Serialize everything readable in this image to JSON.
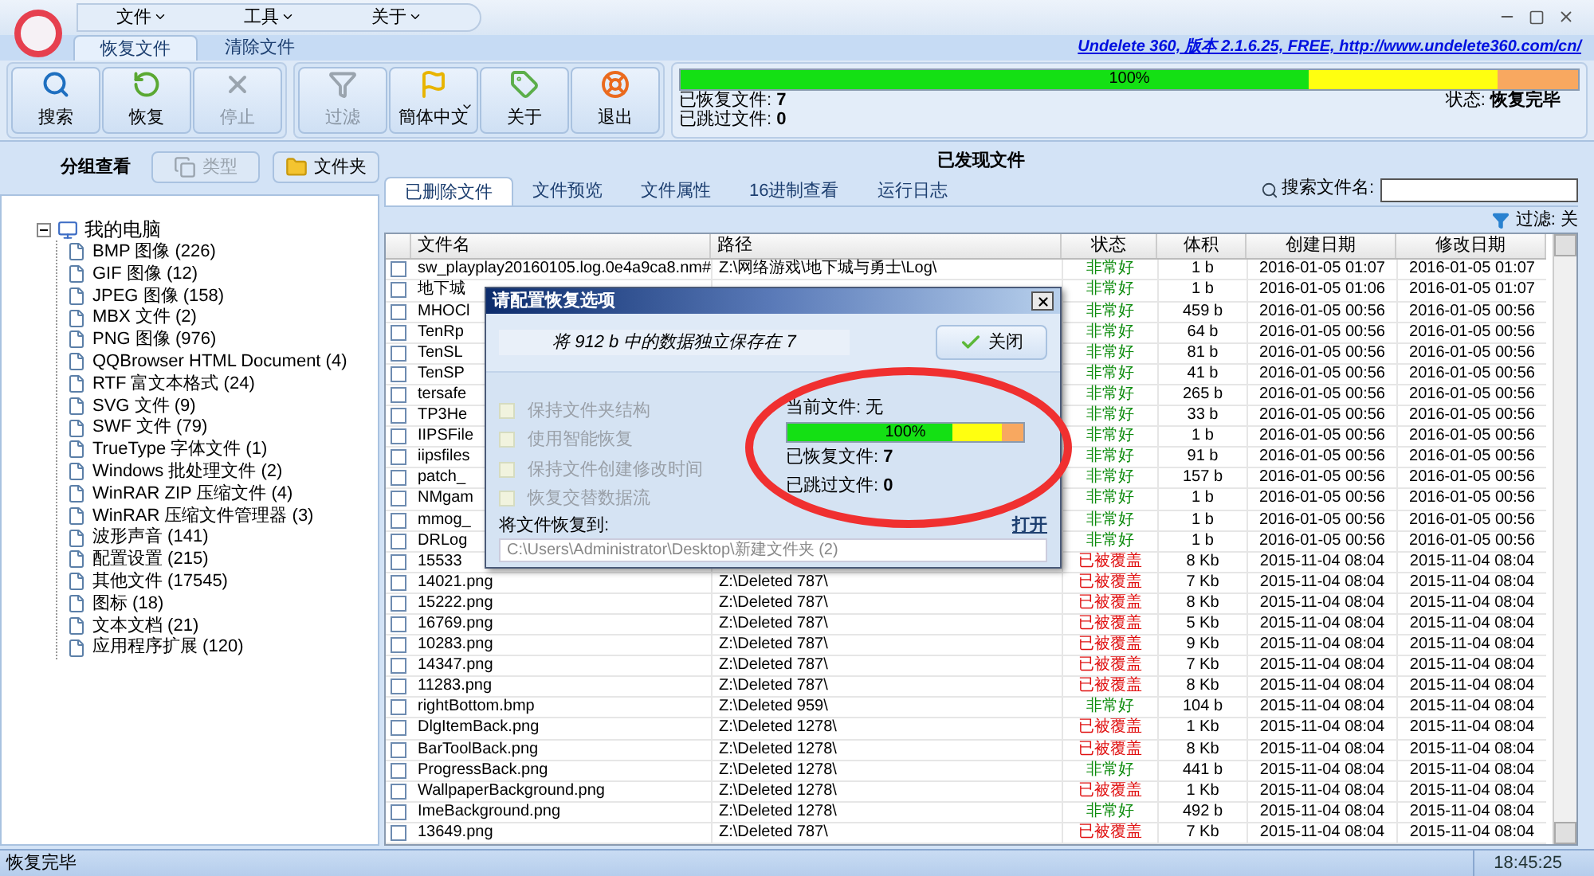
{
  "menu": [
    {
      "label": "文件"
    },
    {
      "label": "工具"
    },
    {
      "label": "关于"
    }
  ],
  "ribbon": {
    "tabs": [
      {
        "label": "恢复文件",
        "selected": true
      },
      {
        "label": "清除文件",
        "selected": false
      }
    ],
    "link": "Undelete 360, 版本 2.1.6.25, FREE, http://www.undelete360.com/cn/",
    "groups": [
      [
        {
          "label": "搜索",
          "kind": "search",
          "disabled": false
        },
        {
          "label": "恢复",
          "kind": "restore",
          "disabled": false
        },
        {
          "label": "停止",
          "kind": "stop",
          "disabled": true
        }
      ],
      [
        {
          "label": "过滤",
          "kind": "filter",
          "disabled": true
        },
        {
          "label": "簡体中文",
          "kind": "language",
          "disabled": false,
          "dropdown": true
        },
        {
          "label": "关于",
          "kind": "about",
          "disabled": false
        },
        {
          "label": "退出",
          "kind": "exit",
          "disabled": false
        }
      ]
    ],
    "progress": {
      "level": 1,
      "label": "100%",
      "recovered": "已恢复文件: **7**",
      "skipped": "已跳过文件: **0**",
      "status": "状态: **恢复完毕**"
    }
  },
  "group_view": {
    "label": "分组查看",
    "buttons": [
      {
        "label": "类型",
        "kind": "type",
        "disabled": true
      },
      {
        "label": "文件夹",
        "kind": "folder",
        "disabled": false
      }
    ]
  },
  "tree": {
    "label": "我的电脑",
    "expanded": true,
    "children": [
      {
        "label": "BMP 图像 (226)"
      },
      {
        "label": "GIF 图像 (12)"
      },
      {
        "label": "JPEG 图像 (158)"
      },
      {
        "label": "MBX 文件 (2)"
      },
      {
        "label": "PNG 图像 (976)"
      },
      {
        "label": "QQBrowser HTML Document (4)"
      },
      {
        "label": "RTF 富文本格式 (24)"
      },
      {
        "label": "SVG 文件 (9)"
      },
      {
        "label": "SWF 文件 (79)"
      },
      {
        "label": "TrueType 字体文件 (1)"
      },
      {
        "label": "Windows 批处理文件 (2)"
      },
      {
        "label": "WinRAR ZIP 压缩文件 (4)"
      },
      {
        "label": "WinRAR 压缩文件管理器 (3)"
      },
      {
        "label": "波形声音 (141)"
      },
      {
        "label": "配置设置 (215)"
      },
      {
        "label": "其他文件 (17545)"
      },
      {
        "label": "图标 (18)"
      },
      {
        "label": "文本文档 (21)"
      },
      {
        "label": "应用程序扩展 (120)"
      }
    ]
  },
  "found": {
    "title": "已发现文件",
    "tabs": [
      {
        "label": "已删除文件",
        "selected": true
      },
      {
        "label": "文件预览",
        "selected": false
      },
      {
        "label": "文件属性",
        "selected": false
      },
      {
        "label": "16进制查看",
        "selected": false
      },
      {
        "label": "运行日志",
        "selected": false
      }
    ],
    "search_label": "搜索文件名:",
    "filter": "过滤: 关",
    "columns": [
      "文件名",
      "路径",
      "状态",
      "体积",
      "创建日期",
      "修改日期"
    ],
    "rows": [
      {
        "checked": false,
        "name": "sw_playplay20160105.log.0e4a9ca8.nm#",
        "path": "Z:\\网络游戏\\地下城与勇士\\Log\\",
        "color": "#0a8a0a",
        "status": "非常好",
        "size": "1 b",
        "created": "2016-01-05 01:07",
        "modified": "2016-01-05 01:07"
      },
      {
        "checked": false,
        "name": "地下城",
        "color": "#0a8a0a",
        "status": "非常好",
        "size": "1 b",
        "created": "2016-01-05 01:06",
        "modified": "2016-01-05 01:07"
      },
      {
        "checked": false,
        "name": "MHOCl",
        "color": "#0a8a0a",
        "status": "非常好",
        "size": "459 b",
        "created": "2016-01-05 00:56",
        "modified": "2016-01-05 00:56"
      },
      {
        "checked": false,
        "name": "TenRp",
        "color": "#0a8a0a",
        "status": "非常好",
        "size": "64 b",
        "created": "2016-01-05 00:56",
        "modified": "2016-01-05 00:56"
      },
      {
        "checked": false,
        "name": "TenSL",
        "color": "#0a8a0a",
        "status": "非常好",
        "size": "81 b",
        "created": "2016-01-05 00:56",
        "modified": "2016-01-05 00:56"
      },
      {
        "checked": false,
        "name": "TenSP",
        "color": "#0a8a0a",
        "status": "非常好",
        "size": "41 b",
        "created": "2016-01-05 00:56",
        "modified": "2016-01-05 00:56"
      },
      {
        "checked": false,
        "name": "tersafe",
        "color": "#0a8a0a",
        "status": "非常好",
        "size": "265 b",
        "created": "2016-01-05 00:56",
        "modified": "2016-01-05 00:56"
      },
      {
        "checked": false,
        "name": "TP3He",
        "color": "#0a8a0a",
        "status": "非常好",
        "size": "33 b",
        "created": "2016-01-05 00:56",
        "modified": "2016-01-05 00:56"
      },
      {
        "checked": false,
        "name": "IIPSFile",
        "color": "#0a8a0a",
        "status": "非常好",
        "size": "1 b",
        "created": "2016-01-05 00:56",
        "modified": "2016-01-05 00:56"
      },
      {
        "checked": false,
        "name": "iipsfiles",
        "color": "#0a8a0a",
        "status": "非常好",
        "size": "91 b",
        "created": "2016-01-05 00:56",
        "modified": "2016-01-05 00:56"
      },
      {
        "checked": false,
        "name": "patch_",
        "color": "#0a8a0a",
        "status": "非常好",
        "size": "157 b",
        "created": "2016-01-05 00:56",
        "modified": "2016-01-05 00:56"
      },
      {
        "checked": false,
        "name": "NMgam",
        "color": "#0a8a0a",
        "status": "非常好",
        "size": "1 b",
        "created": "2016-01-05 00:56",
        "modified": "2016-01-05 00:56"
      },
      {
        "checked": false,
        "name": "mmog_",
        "color": "#0a8a0a",
        "status": "非常好",
        "size": "1 b",
        "created": "2016-01-05 00:56",
        "modified": "2016-01-05 00:56"
      },
      {
        "checked": false,
        "name": "DRLog",
        "color": "#0a8a0a",
        "status": "非常好",
        "size": "1 b",
        "created": "2016-01-05 00:56",
        "modified": "2016-01-05 00:56"
      },
      {
        "checked": false,
        "name": "15533",
        "color": "#e01010",
        "status": "已被覆盖",
        "size": "8 Kb",
        "created": "2015-11-04 08:04",
        "modified": "2015-11-04 08:04"
      },
      {
        "checked": false,
        "name": "14021.png",
        "path": "Z:\\Deleted 787\\",
        "color": "#e01010",
        "status": "已被覆盖",
        "size": "7 Kb",
        "created": "2015-11-04 08:04",
        "modified": "2015-11-04 08:04"
      },
      {
        "checked": false,
        "name": "15222.png",
        "path": "Z:\\Deleted 787\\",
        "color": "#e01010",
        "status": "已被覆盖",
        "size": "8 Kb",
        "created": "2015-11-04 08:04",
        "modified": "2015-11-04 08:04"
      },
      {
        "checked": false,
        "name": "16769.png",
        "path": "Z:\\Deleted 787\\",
        "color": "#e01010",
        "status": "已被覆盖",
        "size": "5 Kb",
        "created": "2015-11-04 08:04",
        "modified": "2015-11-04 08:04"
      },
      {
        "checked": false,
        "name": "10283.png",
        "path": "Z:\\Deleted 787\\",
        "color": "#e01010",
        "status": "已被覆盖",
        "size": "9 Kb",
        "created": "2015-11-04 08:04",
        "modified": "2015-11-04 08:04"
      },
      {
        "checked": false,
        "name": "14347.png",
        "path": "Z:\\Deleted 787\\",
        "color": "#e01010",
        "status": "已被覆盖",
        "size": "7 Kb",
        "created": "2015-11-04 08:04",
        "modified": "2015-11-04 08:04"
      },
      {
        "checked": false,
        "name": "11283.png",
        "path": "Z:\\Deleted 787\\",
        "color": "#e01010",
        "status": "已被覆盖",
        "size": "8 Kb",
        "created": "2015-11-04 08:04",
        "modified": "2015-11-04 08:04"
      },
      {
        "checked": false,
        "name": "rightBottom.bmp",
        "path": "Z:\\Deleted 959\\",
        "color": "#0a8a0a",
        "status": "非常好",
        "size": "104 b",
        "created": "2015-11-04 08:04",
        "modified": "2015-11-04 08:04"
      },
      {
        "checked": false,
        "name": "DlgItemBack.png",
        "path": "Z:\\Deleted 1278\\",
        "color": "#e01010",
        "status": "已被覆盖",
        "size": "1 Kb",
        "created": "2015-11-04 08:04",
        "modified": "2015-11-04 08:04"
      },
      {
        "checked": false,
        "name": "BarToolBack.png",
        "path": "Z:\\Deleted 1278\\",
        "color": "#e01010",
        "status": "已被覆盖",
        "size": "8 Kb",
        "created": "2015-11-04 08:04",
        "modified": "2015-11-04 08:04"
      },
      {
        "checked": false,
        "name": "ProgressBack.png",
        "path": "Z:\\Deleted 1278\\",
        "color": "#0a8a0a",
        "status": "非常好",
        "size": "441 b",
        "created": "2015-11-04 08:04",
        "modified": "2015-11-04 08:04"
      },
      {
        "checked": false,
        "name": "WallpaperBackground.png",
        "path": "Z:\\Deleted 1278\\",
        "color": "#e01010",
        "status": "已被覆盖",
        "size": "1 Kb",
        "created": "2015-11-04 08:04",
        "modified": "2015-11-04 08:04"
      },
      {
        "checked": false,
        "name": "ImeBackground.png",
        "path": "Z:\\Deleted 1278\\",
        "color": "#0a8a0a",
        "status": "非常好",
        "size": "492 b",
        "created": "2015-11-04 08:04",
        "modified": "2015-11-04 08:04"
      },
      {
        "checked": false,
        "name": "13649.png",
        "path": "Z:\\Deleted 787\\",
        "color": "#e01010",
        "status": "已被覆盖",
        "size": "7 Kb",
        "created": "2015-11-04 08:04",
        "modified": "2015-11-04 08:04"
      }
    ]
  },
  "dialog": {
    "title": "请配置恢复选项",
    "message": "将 912 b 中的数据独立保存在 7",
    "close_button": "关闭",
    "options": [
      {
        "label": "保持文件夹结构",
        "checked": false,
        "disabled": true
      },
      {
        "label": "使用智能恢复",
        "checked": false,
        "disabled": true
      },
      {
        "label": "保持文件创建修改时间",
        "checked": false,
        "disabled": true
      },
      {
        "label": "恢复交替数据流",
        "checked": false,
        "disabled": true
      }
    ],
    "current_file": "当前文件: 无",
    "progress": {
      "level": 1,
      "label": "100%"
    },
    "recovered": "已恢复文件: **7**",
    "skipped": "已跳过文件: **0**",
    "destination_label": "将文件恢复到:",
    "open_link": "打开",
    "destination": "C:\\Users\\Administrator\\Desktop\\新建文件夹 (2)"
  },
  "status_bar": {
    "text": "恢复完毕",
    "time": "18:45:25"
  }
}
